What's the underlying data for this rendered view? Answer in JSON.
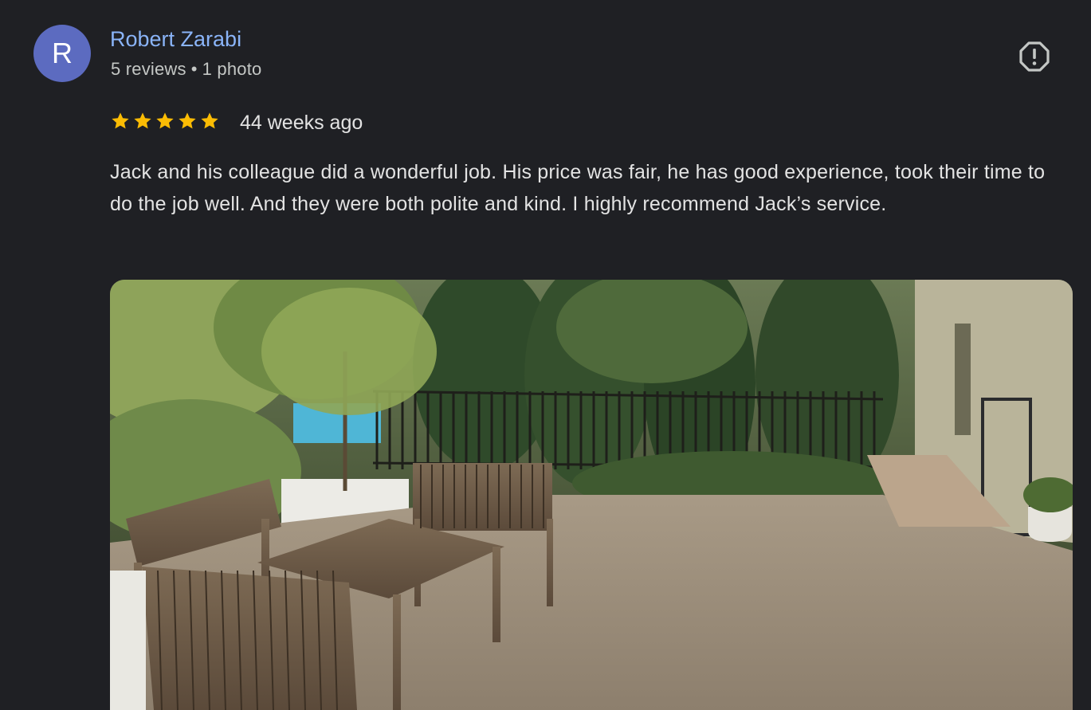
{
  "review": {
    "avatar_initial": "R",
    "author_name": "Robert Zarabi",
    "reviews_count": "5 reviews",
    "separator": "•",
    "photos_count": "1 photo",
    "rating": 5,
    "time_ago": "44 weeks ago",
    "text": "Jack and his colleague did a wonderful job. His price was fair, he has good experience, took their time to do the job well. And they were both polite and kind. I highly recommend Jack’s service.",
    "report_icon": "report-octagon-icon",
    "star_icon": "star-icon",
    "star_color": "#fbbc04",
    "link_color": "#8ab4f8",
    "avatar_color": "#5c6bc0"
  }
}
